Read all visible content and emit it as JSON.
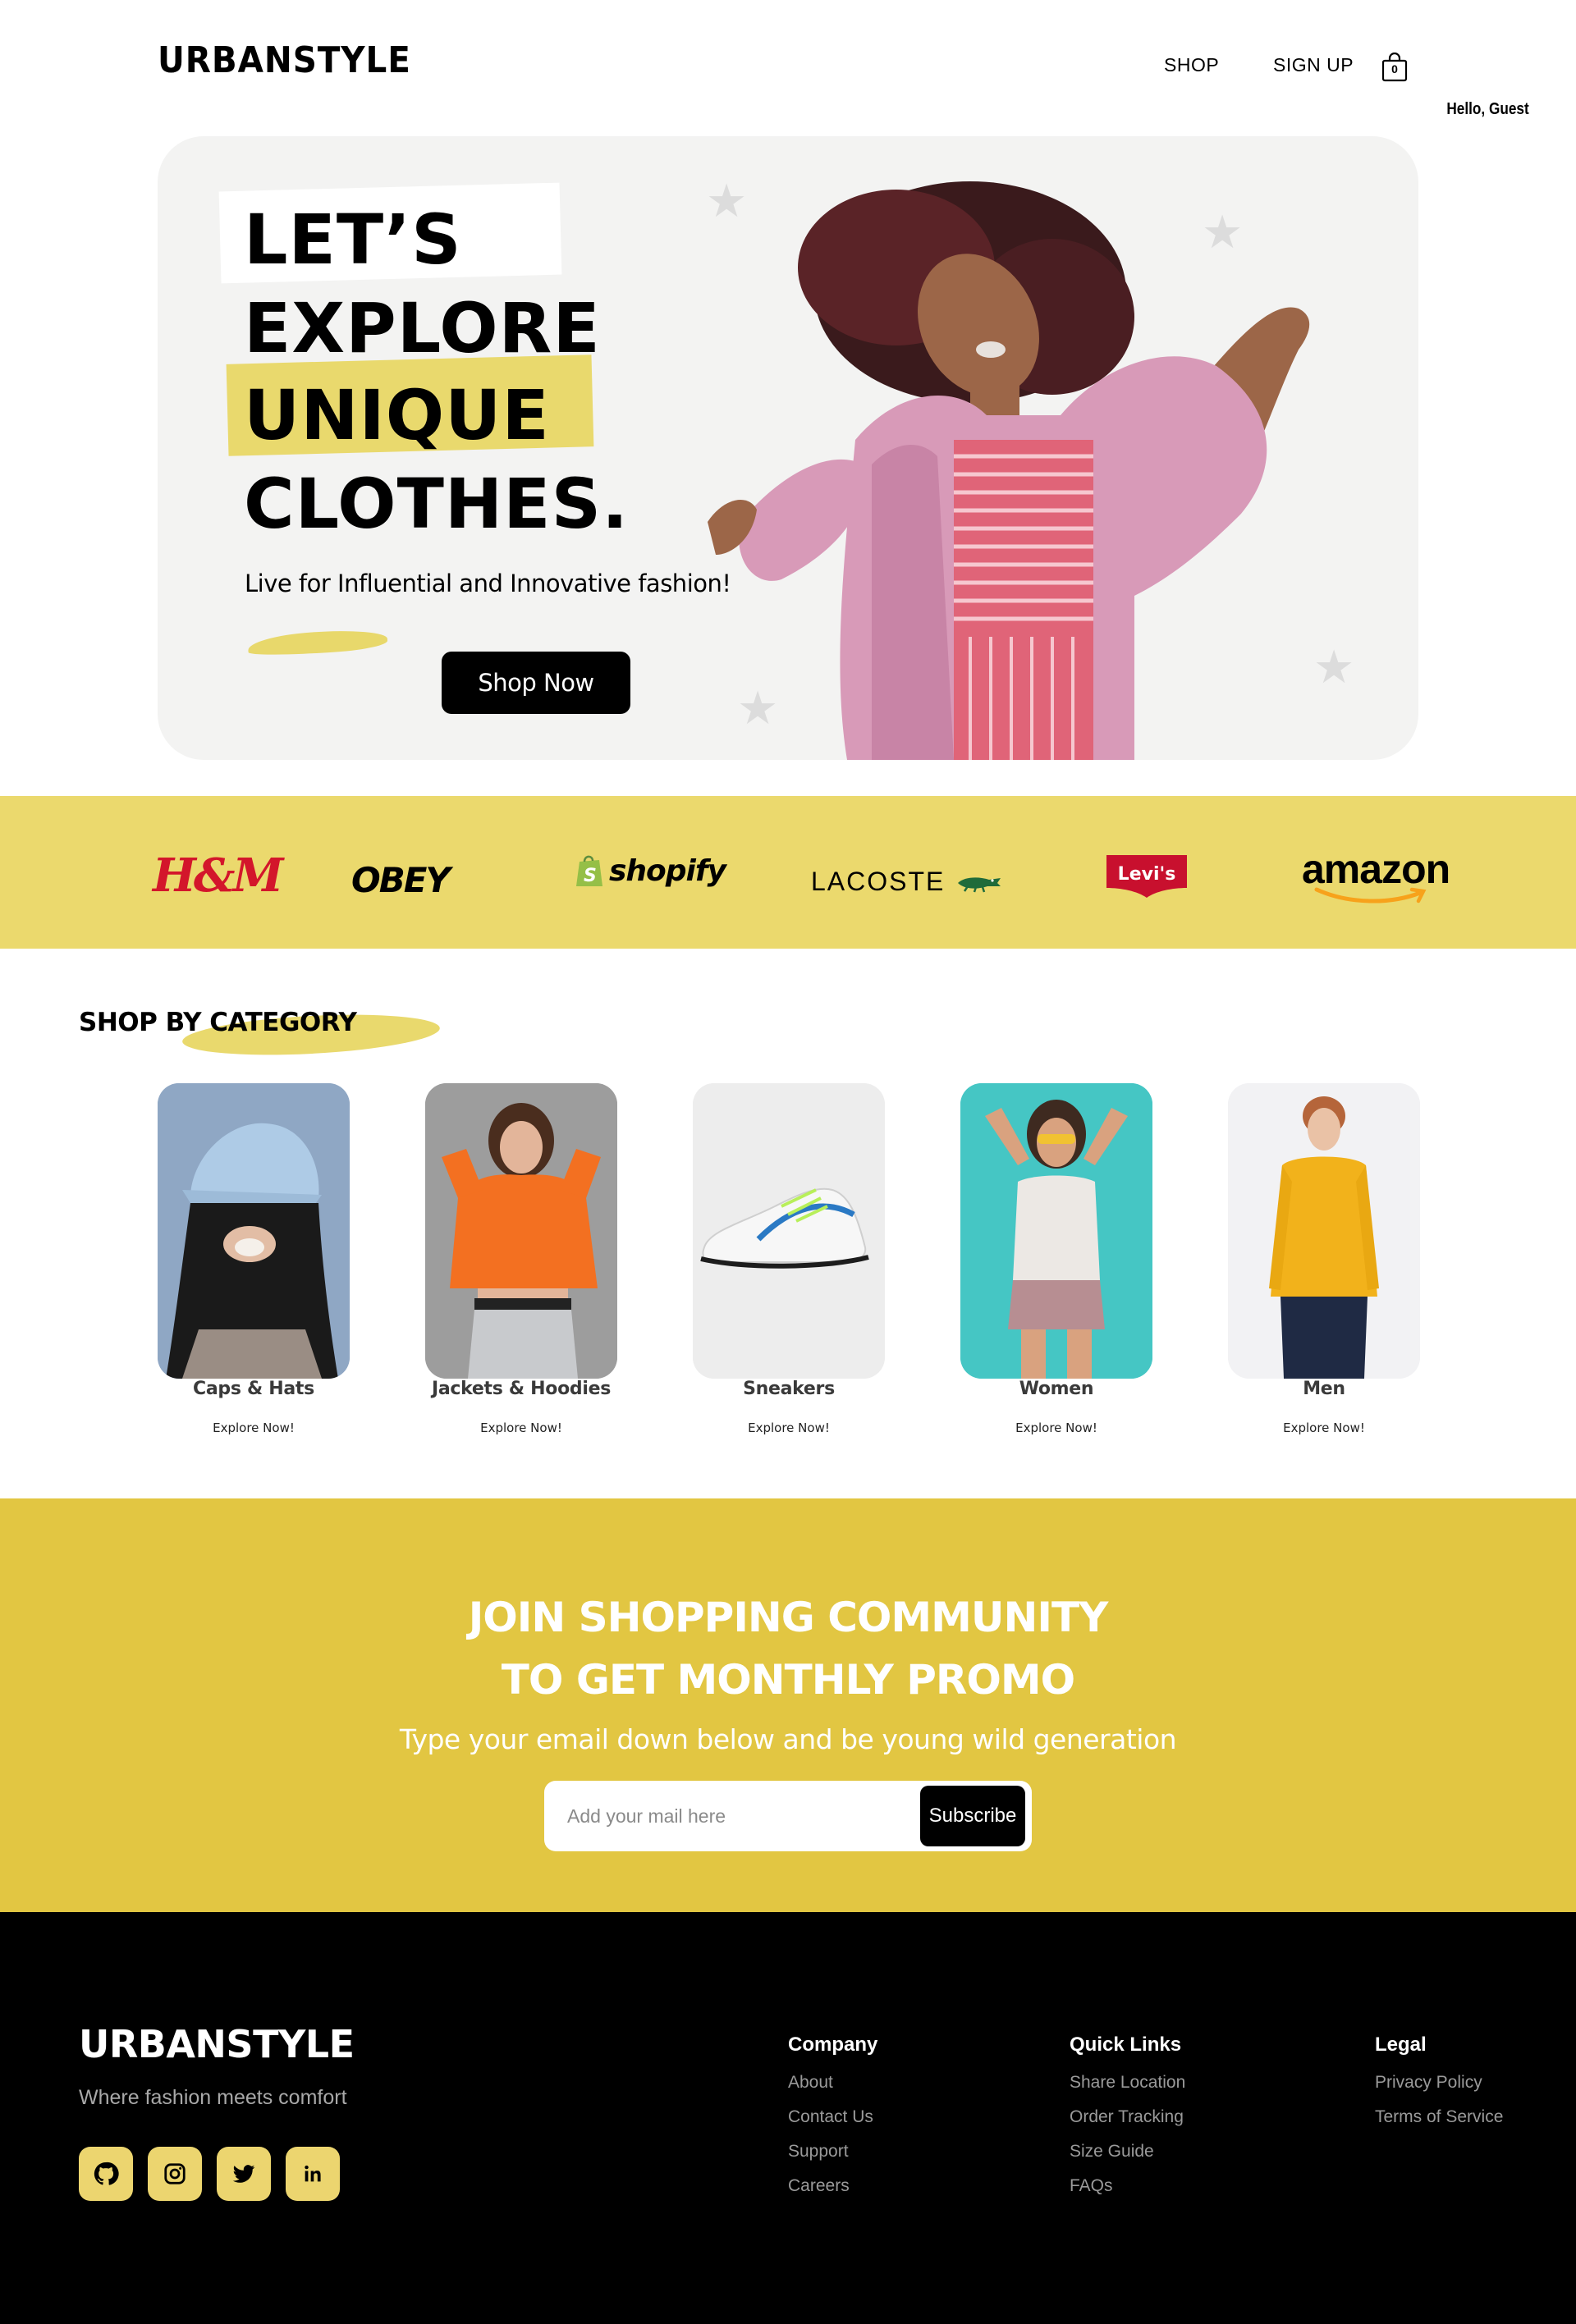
{
  "header": {
    "logo": "URBANSTYLE",
    "nav": [
      "SHOP",
      "SIGN UP"
    ],
    "cart_count": "0",
    "greeting": "Hello, Guest"
  },
  "hero": {
    "lines": [
      "LET’S",
      "EXPLORE",
      "UNIQUE",
      "CLOTHES."
    ],
    "tagline": "Live for Influential and Innovative fashion!",
    "cta": "Shop Now"
  },
  "brands": [
    "H&M",
    "OBEY",
    "shopify",
    "LACOSTE",
    "Levi's",
    "amazon"
  ],
  "categories": {
    "heading": "SHOP BY CATEGORY",
    "items": [
      {
        "name": "Caps & Hats",
        "cta": "Explore Now!"
      },
      {
        "name": "Jackets & Hoodies",
        "cta": "Explore Now!"
      },
      {
        "name": "Sneakers",
        "cta": "Explore Now!"
      },
      {
        "name": "Women",
        "cta": "Explore Now!"
      },
      {
        "name": "Men",
        "cta": "Explore Now!"
      }
    ]
  },
  "newsletter": {
    "title_line1": "JOIN SHOPPING COMMUNITY",
    "title_line2": "TO GET MONTHLY PROMO",
    "subtitle": "Type your email down below and be young wild generation",
    "placeholder": "Add your mail here",
    "button": "Subscribe"
  },
  "footer": {
    "logo": "URBANSTYLE",
    "tagline": "Where fashion meets comfort",
    "social": [
      "github-icon",
      "instagram-icon",
      "twitter-icon",
      "linkedin-icon"
    ],
    "columns": [
      {
        "title": "Company",
        "links": [
          "About",
          "Contact Us",
          "Support",
          "Careers"
        ]
      },
      {
        "title": "Quick Links",
        "links": [
          "Share Location",
          "Order Tracking",
          "Size Guide",
          "FAQs"
        ]
      },
      {
        "title": "Legal",
        "links": [
          "Privacy Policy",
          "Terms of Service"
        ]
      }
    ]
  },
  "colors": {
    "accent_yellow": "#e9d96d",
    "newsletter_bg": "#e2c642",
    "hero_bg": "#f3f3f2",
    "footer_bg": "#000000"
  }
}
